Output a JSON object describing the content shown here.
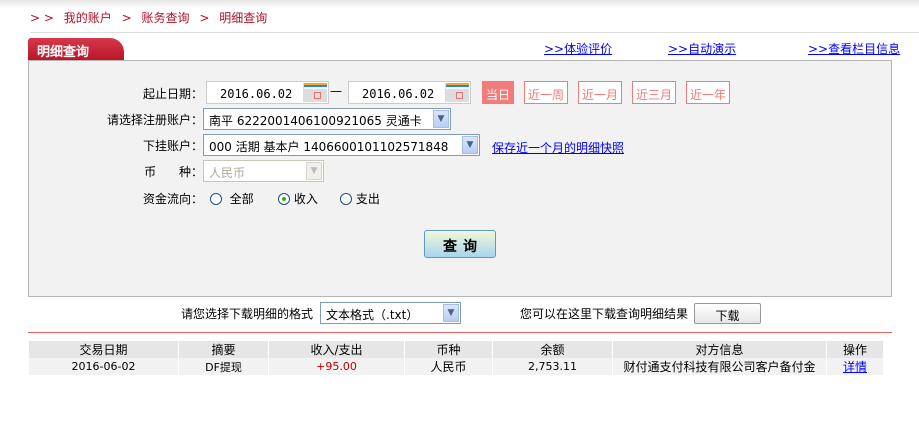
{
  "breadcrumb": {
    "prefix": "> >",
    "items": [
      "我的账户",
      "账务查询",
      "明细查询"
    ],
    "separator": ">"
  },
  "tab": {
    "title": "明细查询"
  },
  "top_links": [
    ">>体验评价",
    ">>自动演示",
    ">>查看栏目信息"
  ],
  "form": {
    "date_label": "起止日期：",
    "start_date": "2016.06.02",
    "dash": "—",
    "end_date": "2016.06.02",
    "quick_ranges": [
      {
        "label": "当日",
        "active": true
      },
      {
        "label": "近一周"
      },
      {
        "label": "近一月"
      },
      {
        "label": "近三月"
      },
      {
        "label": "近一年"
      }
    ],
    "account_label": "请选择注册账户：",
    "account_value": "南平  6222001406100921065  灵通卡",
    "sub_account_label": "下挂账户：",
    "sub_account_value": "000  活期  基本户  1406600101102571848",
    "snapshot_link": "保存近一个月的明细快照",
    "currency_label": "币      种：",
    "currency_value": "人民币",
    "flow_label": "资金流向：",
    "flow_options": [
      "全部",
      "收入",
      "支出"
    ],
    "flow_selected": "收入",
    "query_button": "查询"
  },
  "download": {
    "format_label": "请您选择下载明细的格式",
    "format_value": "文本格式（.txt）",
    "hint": "您可以在这里下载查询明细结果",
    "button": "下载"
  },
  "table": {
    "headers": [
      "交易日期",
      "摘要",
      "收入/支出",
      "币种",
      "余额",
      "对方信息",
      "操作"
    ],
    "rows": [
      [
        "2016-06-02",
        "DF提现",
        "+95.00",
        "人民币",
        "2,753.11",
        "财付通支付科技有限公司客户备付金",
        "详情"
      ]
    ]
  },
  "colors": {
    "brand": "#c0182c",
    "accent_pink": "#f47b7b",
    "link": "#0000ff",
    "amount_income": "#c00000"
  }
}
